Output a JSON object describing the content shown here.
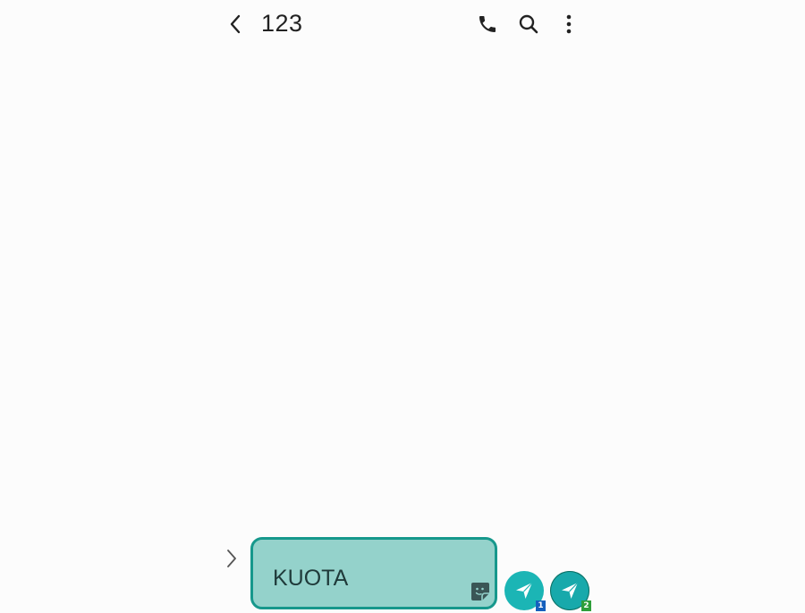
{
  "header": {
    "title": "123",
    "icons": [
      "back-arrow-icon",
      "phone-icon",
      "search-icon",
      "more-vert-icon"
    ]
  },
  "composer": {
    "text": "KUOTA",
    "sticker_icon": "sticker-icon"
  },
  "send_buttons": [
    {
      "sim": "1",
      "badge_color": "#1560bd"
    },
    {
      "sim": "2",
      "badge_color": "#2e9e3a"
    }
  ],
  "colors": {
    "accent": "#16988c",
    "composer_bg": "#94d2cb",
    "send_bg": "#1bb5b5"
  }
}
